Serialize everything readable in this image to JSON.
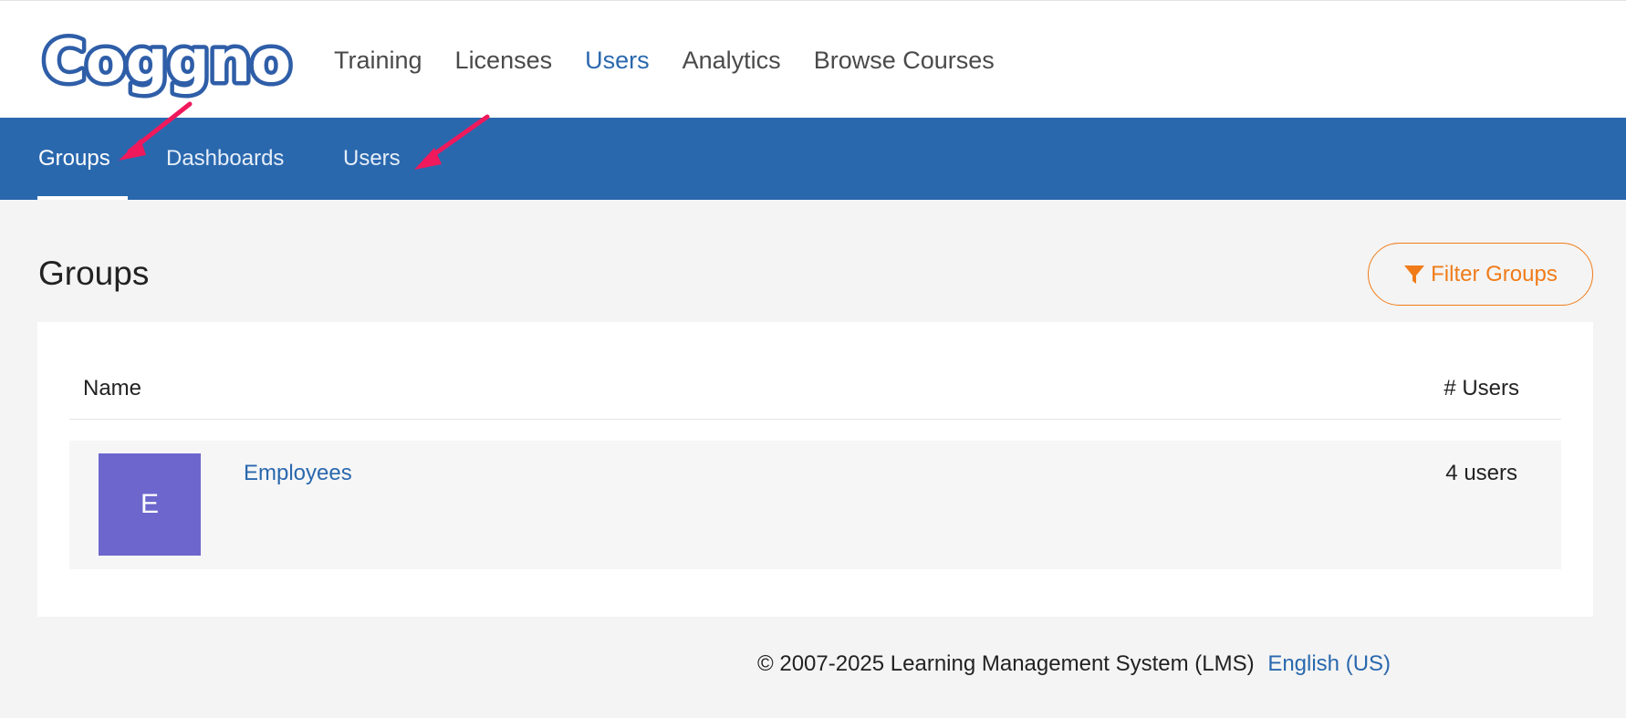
{
  "brand": {
    "logo_text": "Coggno",
    "logo_fill": "#ffffff",
    "logo_stroke": "#2f5ea8"
  },
  "top_nav": {
    "items": [
      {
        "label": "Training"
      },
      {
        "label": "Licenses"
      },
      {
        "label": "Users",
        "active": true
      },
      {
        "label": "Analytics"
      },
      {
        "label": "Browse Courses"
      }
    ]
  },
  "sub_nav": {
    "items": [
      {
        "label": "Groups",
        "active": true
      },
      {
        "label": "Dashboards"
      },
      {
        "label": "Users"
      }
    ]
  },
  "page": {
    "title": "Groups",
    "filter_button_label": "Filter Groups",
    "filter_icon": "filter-icon"
  },
  "table": {
    "columns": {
      "name": "Name",
      "users": "# Users"
    },
    "rows": [
      {
        "avatar_letter": "E",
        "name": "Employees",
        "users": "4 users",
        "avatar_color": "#6c66cd"
      }
    ]
  },
  "footer": {
    "copyright": "© 2007-2025 Learning Management System (LMS)",
    "language": "English (US)"
  },
  "colors": {
    "primary": "#2a68ae",
    "accent": "#f07c19",
    "annotation_arrow": "#f0195c"
  }
}
